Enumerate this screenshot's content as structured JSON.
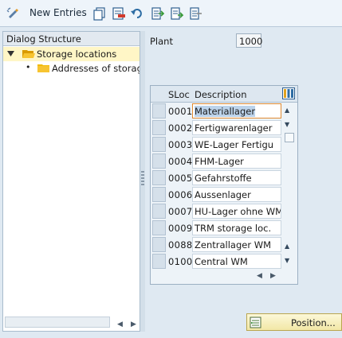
{
  "toolbar": {
    "new_entries_label": "New Entries"
  },
  "dialog_structure": {
    "title": "Dialog Structure",
    "items": [
      {
        "label": "Storage locations"
      },
      {
        "label": "Addresses of storage"
      }
    ]
  },
  "details": {
    "plant_label": "Plant",
    "plant_value": "1000"
  },
  "table": {
    "columns": [
      "SLoc",
      "Description"
    ],
    "rows": [
      {
        "sloc": "0001",
        "description": "Materiallager"
      },
      {
        "sloc": "0002",
        "description": "Fertigwarenlager"
      },
      {
        "sloc": "0003",
        "description": "WE-Lager Fertigu"
      },
      {
        "sloc": "0004",
        "description": "FHM-Lager"
      },
      {
        "sloc": "0005",
        "description": "Gefahrstoffe"
      },
      {
        "sloc": "0006",
        "description": "Aussenlager"
      },
      {
        "sloc": "0007",
        "description": "HU-Lager ohne WM"
      },
      {
        "sloc": "0009",
        "description": "TRM storage loc."
      },
      {
        "sloc": "0088",
        "description": "Zentrallager WM"
      },
      {
        "sloc": "0100",
        "description": "Central WM"
      }
    ]
  },
  "position_button": {
    "label": "Position..."
  },
  "colors": {
    "tree_selected": "#fff6c6",
    "folder": "#f0b400",
    "accent_orange": "#e08a30"
  }
}
